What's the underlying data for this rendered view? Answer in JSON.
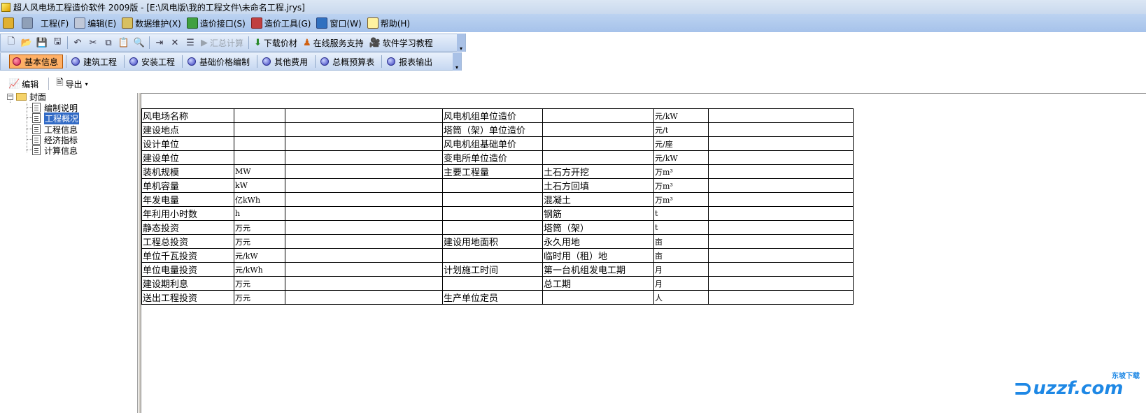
{
  "window": {
    "title": "超人风电场工程造价软件 2009版 - [E:\\风电版\\我的工程文件\\未命名工程.jrys]"
  },
  "menu": [
    {
      "label": "",
      "icon": "person-icon"
    },
    {
      "label": "",
      "icon": "tools-icon"
    },
    {
      "label": "工程(F)",
      "icon": "project-icon"
    },
    {
      "label": "编辑(E)",
      "icon": "edit-icon"
    },
    {
      "label": "数据维护(X)",
      "icon": "database-icon"
    },
    {
      "label": "造价接口(S)",
      "icon": "interface-icon"
    },
    {
      "label": "造价工具(G)",
      "icon": "wrench-icon"
    },
    {
      "label": "窗口(W)",
      "icon": "window-icon"
    },
    {
      "label": "帮助(H)",
      "icon": "help-icon"
    }
  ],
  "toolbar1": {
    "summary_label": "汇总计算",
    "download_label": "下载价材",
    "online_label": "在线服务支持",
    "tutorial_label": "软件学习教程"
  },
  "nav_tabs": [
    {
      "label": "基本信息",
      "active": true
    },
    {
      "label": "建筑工程",
      "active": false
    },
    {
      "label": "安装工程",
      "active": false
    },
    {
      "label": "基础价格编制",
      "active": false
    },
    {
      "label": "其他费用",
      "active": false
    },
    {
      "label": "总概预算表",
      "active": false
    },
    {
      "label": "报表输出",
      "active": false
    }
  ],
  "subbar": {
    "edit_label": "编辑",
    "export_label": "导出"
  },
  "tree": {
    "root": "封面",
    "children": [
      "编制说明",
      "工程概况",
      "工程信息",
      "经济指标",
      "计算信息"
    ],
    "selected": "工程概况"
  },
  "table": [
    [
      "风电场名称",
      "",
      "",
      "风电机组单位造价",
      "",
      "元/kW",
      ""
    ],
    [
      "建设地点",
      "",
      "",
      "塔筒（架）单位造价",
      "",
      "元/t",
      ""
    ],
    [
      "设计单位",
      "",
      "",
      "风电机组基础单价",
      "",
      "元/座",
      ""
    ],
    [
      "建设单位",
      "",
      "",
      "变电所单位造价",
      "",
      "元/kW",
      ""
    ],
    [
      "装机规模",
      "MW",
      "",
      "主要工程量",
      "土石方开挖",
      "万m³",
      ""
    ],
    [
      "单机容量",
      "kW",
      "",
      "",
      "土石方回填",
      "万m³",
      ""
    ],
    [
      "年发电量",
      "亿kWh",
      "",
      "",
      "混凝土",
      "万m³",
      ""
    ],
    [
      "年利用小时数",
      "h",
      "",
      "",
      "钢筋",
      "t",
      ""
    ],
    [
      "静态投资",
      "万元",
      "",
      "",
      "塔筒（架）",
      "t",
      ""
    ],
    [
      "工程总投资",
      "万元",
      "",
      "建设用地面积",
      "永久用地",
      "亩",
      ""
    ],
    [
      "单位千瓦投资",
      "元/kW",
      "",
      "",
      "临时用（租）地",
      "亩",
      ""
    ],
    [
      "单位电量投资",
      "元/kWh",
      "",
      "计划施工时间",
      "第一台机组发电工期",
      "月",
      ""
    ],
    [
      "建设期利息",
      "万元",
      "",
      "",
      "总工期",
      "月",
      ""
    ],
    [
      "送出工程投资",
      "万元",
      "",
      "生产单位定员",
      "",
      "人",
      ""
    ]
  ],
  "watermark": {
    "text": "uzzf.com",
    "sub": "东坡下载"
  }
}
